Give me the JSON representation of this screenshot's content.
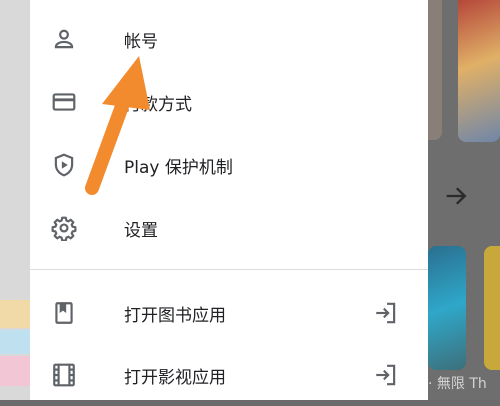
{
  "drawer": {
    "items": [
      {
        "label": "帐号",
        "icon": "person-icon"
      },
      {
        "label": "付款方式",
        "icon": "credit-card-icon"
      },
      {
        "label": "Play 保护机制",
        "icon": "shield-play-icon"
      },
      {
        "label": "设置",
        "icon": "gear-icon"
      }
    ],
    "app_items": [
      {
        "label": "打开图书应用",
        "icon": "bookmark-book-icon",
        "trailing_icon": "open-in-app-icon"
      },
      {
        "label": "打开影视应用",
        "icon": "film-icon",
        "trailing_icon": "open-in-app-icon"
      }
    ]
  },
  "background": {
    "caption": "· 無限  Th"
  },
  "colors": {
    "annotation_arrow": "#f28a2e",
    "icon": "#5f6368",
    "text": "#202124"
  }
}
